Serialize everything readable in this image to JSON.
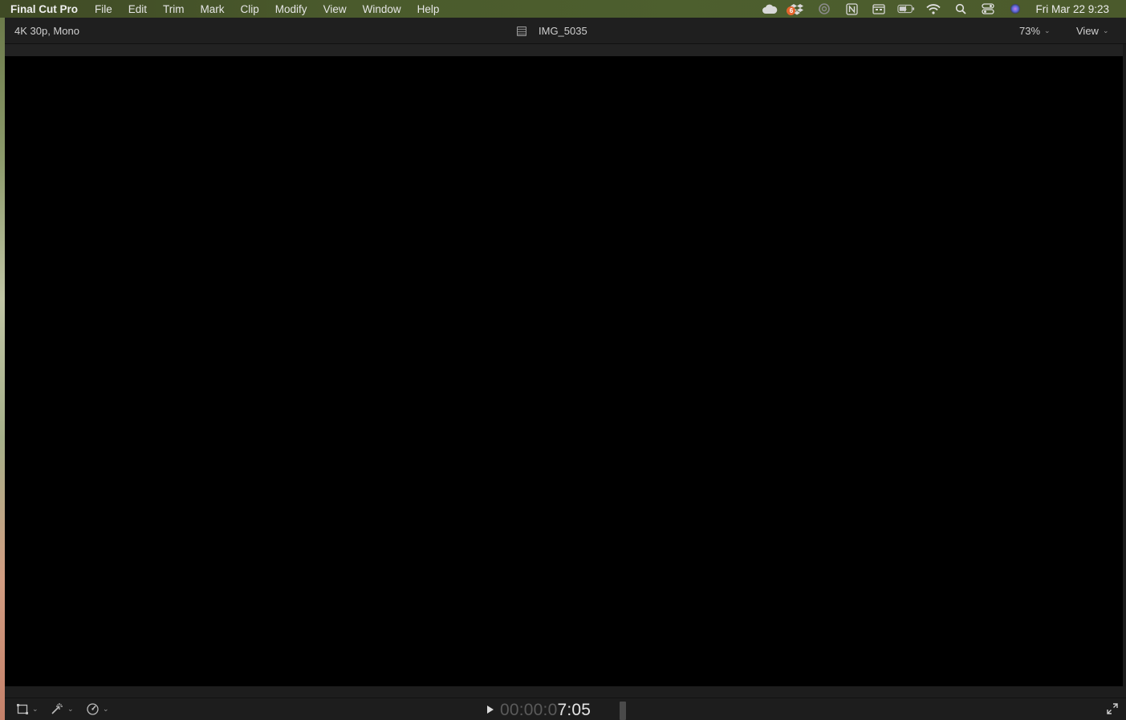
{
  "menubar": {
    "app_name": "Final Cut Pro",
    "items": [
      "File",
      "Edit",
      "Trim",
      "Mark",
      "Clip",
      "Modify",
      "View",
      "Window",
      "Help"
    ],
    "status_icons": [
      "creative-cloud-icon",
      "dropbox-icon",
      "cc-circle-icon",
      "notion-icon",
      "calendar-icon",
      "battery-icon",
      "wifi-icon",
      "spotlight-search-icon",
      "control-center-icon",
      "siri-icon"
    ],
    "badge_count": "6",
    "clock": "Fri Mar 22  9:23"
  },
  "viewer": {
    "format": "4K 30p, Mono",
    "clip_name": "IMG_5035",
    "zoom": "73%",
    "view_label": "View"
  },
  "controls": {
    "timecode_dim": "00:00:0",
    "timecode_bright": "7:05"
  },
  "colors": {
    "menubar_bg": "#4a5a2c",
    "viewer_bg": "#1f1f1f",
    "canvas_bg": "#000000"
  }
}
